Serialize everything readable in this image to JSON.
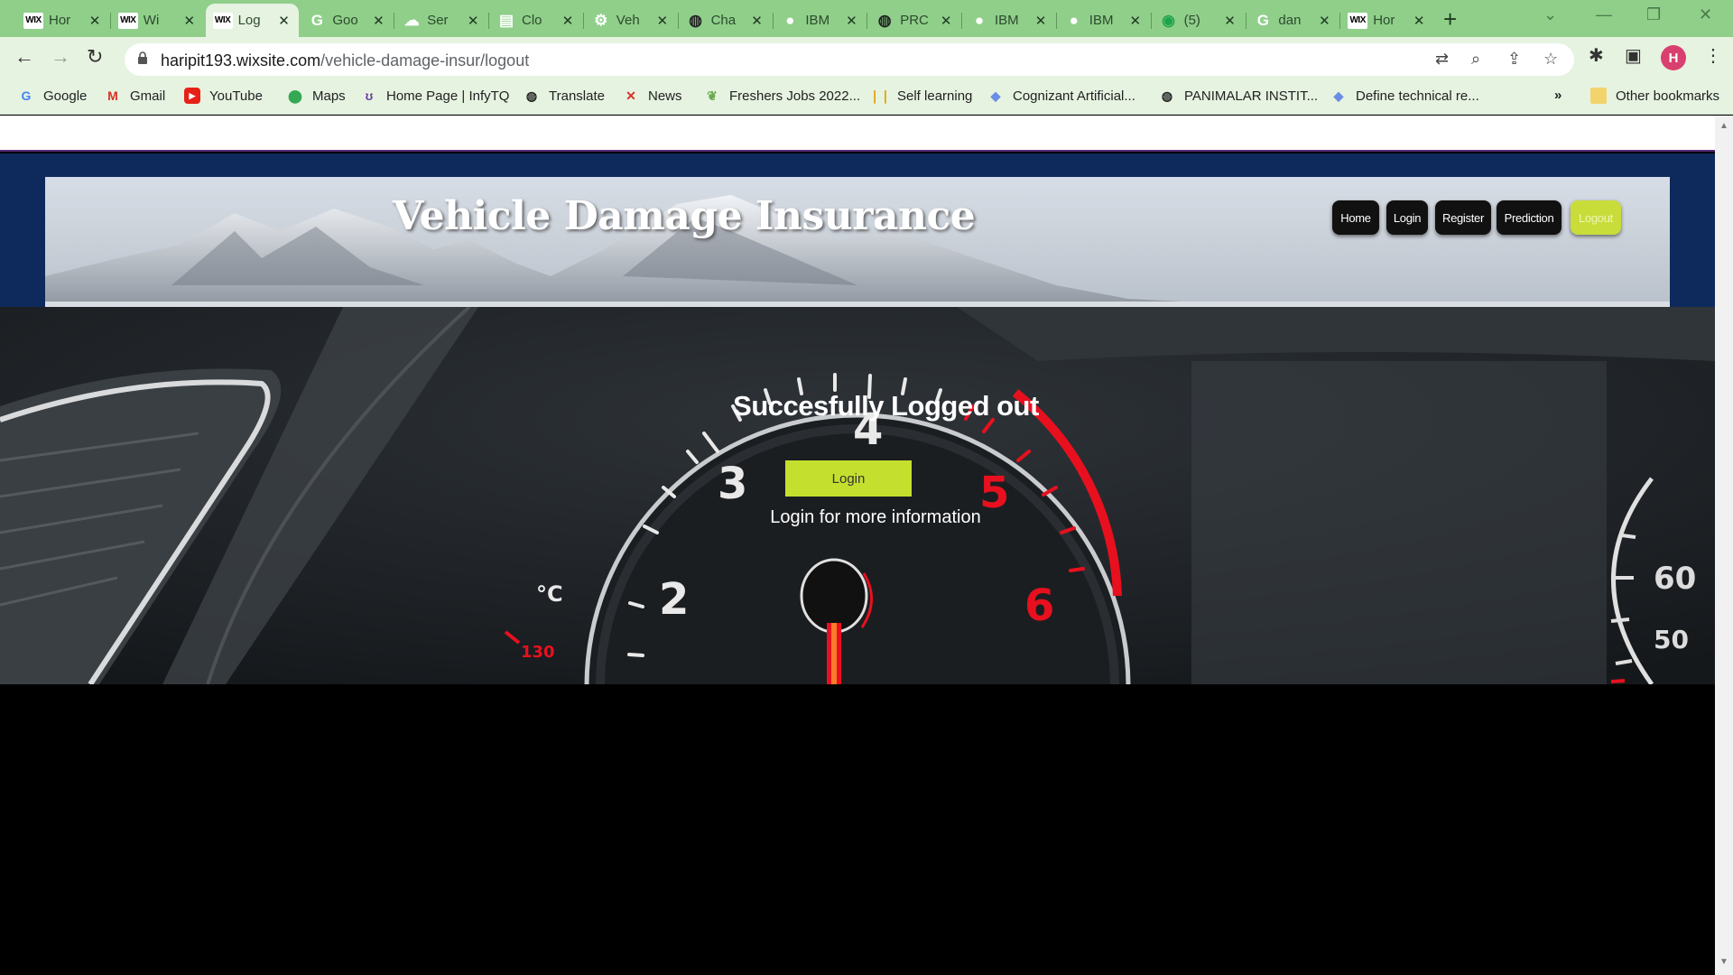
{
  "browser": {
    "tabs": [
      {
        "title": "Hor",
        "icon": "wix-icon"
      },
      {
        "title": "Wi",
        "icon": "wix-icon"
      },
      {
        "title": "Log",
        "icon": "wix-icon",
        "active": true
      },
      {
        "title": "Goo",
        "icon": "google-icon"
      },
      {
        "title": "Ser",
        "icon": "cloud-icon"
      },
      {
        "title": "Clo",
        "icon": "cloud-doc-icon"
      },
      {
        "title": "Veh",
        "icon": "gear-icon"
      },
      {
        "title": "Cha",
        "icon": "globe-icon"
      },
      {
        "title": "IBM",
        "icon": "github-icon"
      },
      {
        "title": "PRC",
        "icon": "globe-icon"
      },
      {
        "title": "IBM",
        "icon": "github-icon"
      },
      {
        "title": "IBM",
        "icon": "github-icon"
      },
      {
        "title": "(5)",
        "icon": "whatsapp-icon"
      },
      {
        "title": "dan",
        "icon": "google-icon"
      },
      {
        "title": "Hor",
        "icon": "wix-icon"
      }
    ],
    "url_host": "haripit193.wixsite.com",
    "url_path": "/vehicle-damage-insur/logout",
    "profile_initial": "H",
    "bookmarks": [
      {
        "label": "Google",
        "icon": "google-icon"
      },
      {
        "label": "Gmail",
        "icon": "gmail-icon"
      },
      {
        "label": "YouTube",
        "icon": "youtube-icon"
      },
      {
        "label": "Maps",
        "icon": "maps-icon"
      },
      {
        "label": "Home Page | InfyTQ",
        "icon": "infytq-icon"
      },
      {
        "label": "Translate",
        "icon": "globe-icon"
      },
      {
        "label": "News",
        "icon": "news-icon"
      },
      {
        "label": "Freshers Jobs 2022...",
        "icon": "leaf-icon"
      },
      {
        "label": "Self learning",
        "icon": "bars-icon"
      },
      {
        "label": "Cognizant Artificial...",
        "icon": "diamond-icon"
      },
      {
        "label": "PANIMALAR INSTIT...",
        "icon": "globe-icon"
      },
      {
        "label": "Define technical re...",
        "icon": "diamond-icon"
      }
    ],
    "bookmarks_overflow": "»",
    "other_bookmarks": "Other bookmarks"
  },
  "site": {
    "title": "Vehicle Damage Insurance",
    "nav": [
      {
        "label": "Home"
      },
      {
        "label": "Login"
      },
      {
        "label": "Register"
      },
      {
        "label": "Prediction"
      },
      {
        "label": "Logout",
        "active": true
      }
    ]
  },
  "hero": {
    "heading": "Succesfully Logged out",
    "button_label": "Login",
    "subtext": "Login for more information",
    "gauge_numbers": [
      "2",
      "3",
      "4",
      "5",
      "6"
    ],
    "temp_unit": "°C",
    "temp_value": "130",
    "right_gauge_top": "60",
    "right_gauge_bottom": "50"
  },
  "colors": {
    "tabstrip": "#8fcf8a",
    "toolbar": "#e6f3e1",
    "header_band": "#0e2a5c",
    "accent_button": "#c5df2e",
    "gauge_red": "#e8101e"
  }
}
